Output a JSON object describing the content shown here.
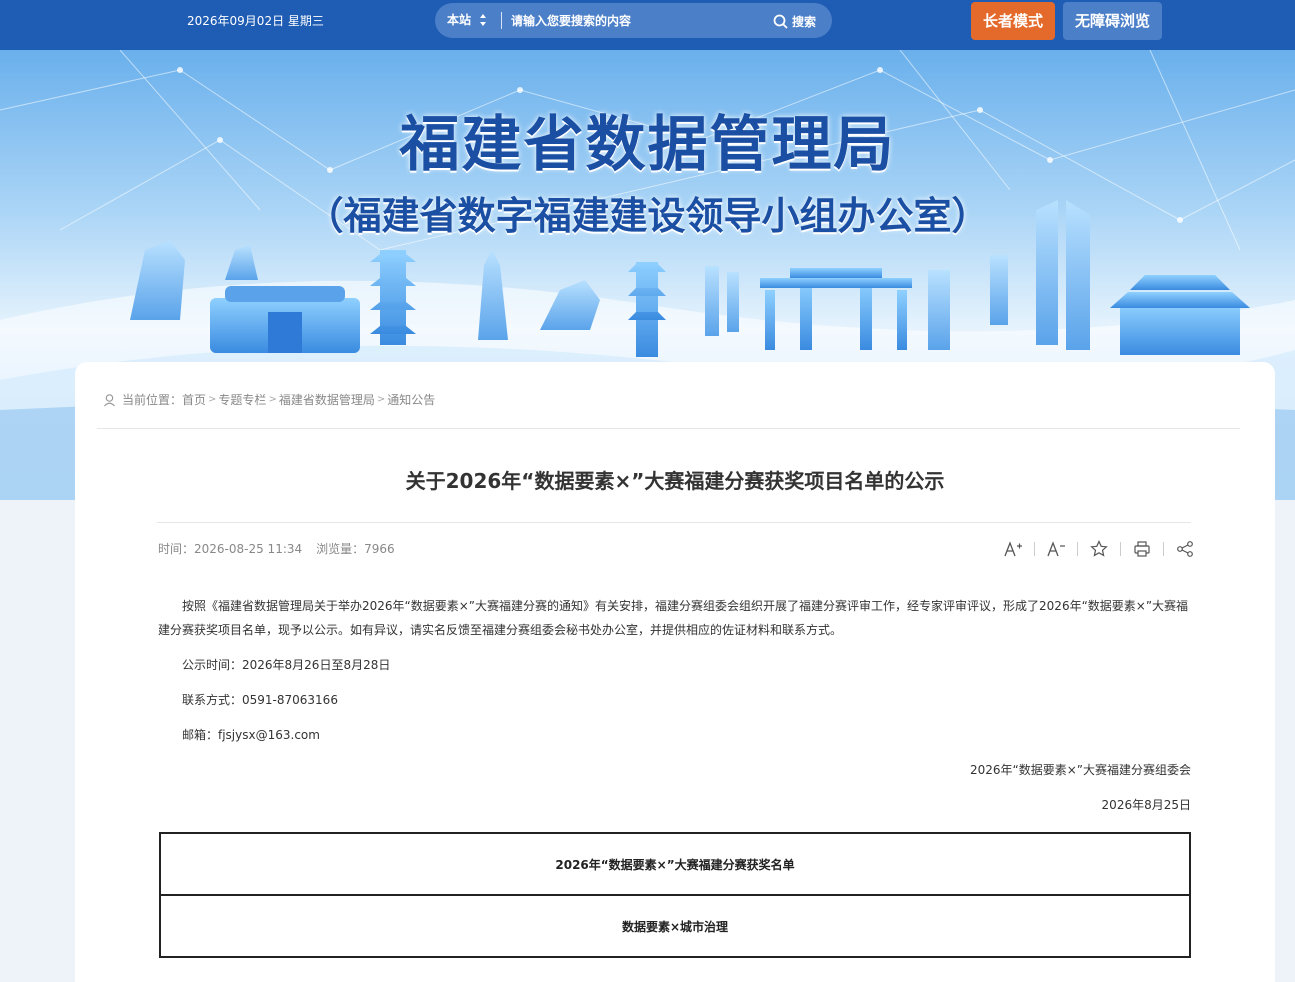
{
  "topbar": {
    "date": "2026年09月02日 星期三",
    "search": {
      "scope": "本站",
      "placeholder": "请输入您要搜索的内容",
      "button": "搜索"
    },
    "elder_mode": "长者模式",
    "accessibility": "无障碍浏览",
    "colors": {
      "bar": "#1f5cb4",
      "elder": "#e46a2b",
      "access": "#4b7fc8"
    }
  },
  "banner": {
    "title": "福建省数据管理局",
    "subtitle": "（福建省数字福建建设领导小组办公室）"
  },
  "breadcrumb": {
    "label": "当前位置：",
    "items": [
      "首页",
      "专题专栏",
      "福建省数据管理局",
      "通知公告"
    ]
  },
  "article": {
    "title": "关于2026年“数据要素×”大赛福建分赛获奖项目名单的公示",
    "meta_time": "时间：2026-08-25 11:34",
    "meta_views": "浏览量：7966",
    "tools": [
      "font-increase-icon",
      "font-decrease-icon",
      "star-icon",
      "print-icon",
      "share-icon"
    ],
    "paragraph": "按照《福建省数据管理局关于举办2026年“数据要素×”大赛福建分赛的通知》有关安排，福建分赛组委会组织开展了福建分赛评审工作，经专家评审评议，形成了2026年“数据要素×”大赛福建分赛获奖项目名单，现予以公示。如有异议，请实名反馈至福建分赛组委会秘书处办公室，并提供相应的佐证材料和联系方式。",
    "notice_period": "公示时间：2026年8月26日至8月28日",
    "contact": "联系方式：0591-87063166",
    "email": "邮箱：fjsjysx@163.com",
    "signature": "2026年“数据要素×”大赛福建分赛组委会",
    "date": "2026年8月25日"
  },
  "table": {
    "heading": "2026年“数据要素×”大赛福建分赛获奖名单",
    "section": "数据要素×城市治理"
  }
}
